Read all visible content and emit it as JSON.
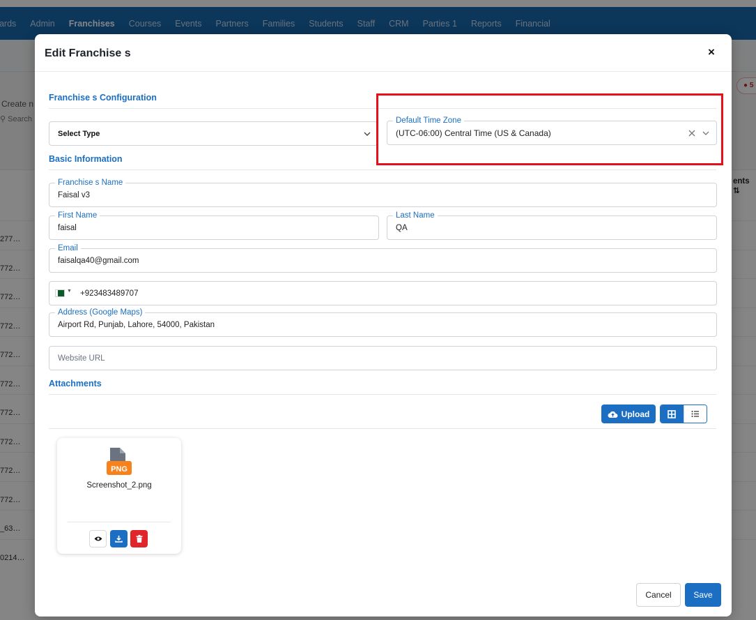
{
  "nav": {
    "items": [
      {
        "label": "oards",
        "active": false
      },
      {
        "label": "Admin",
        "active": false
      },
      {
        "label": "Franchises",
        "active": true
      },
      {
        "label": "Courses",
        "active": false
      },
      {
        "label": "Events",
        "active": false
      },
      {
        "label": "Partners",
        "active": false
      },
      {
        "label": "Families",
        "active": false
      },
      {
        "label": "Students",
        "active": false
      },
      {
        "label": "Staff",
        "active": false
      },
      {
        "label": "CRM",
        "active": false
      },
      {
        "label": "Parties 1",
        "active": false
      },
      {
        "label": "Reports",
        "active": false
      },
      {
        "label": "Financial",
        "active": false
      }
    ]
  },
  "background": {
    "create_label": "Create n",
    "search_label": "Search",
    "badge_text": "5",
    "column_header": "ents ⇅",
    "rows": [
      "277…",
      "772…",
      "772…",
      "772…",
      "772…",
      "772…",
      "772…",
      "772…",
      "772…",
      "772…",
      "_63…",
      "0214…"
    ]
  },
  "modal": {
    "title": "Edit Franchise s",
    "close_label": "×",
    "config_section": "Franchise s Configuration",
    "select_type": {
      "value": "Select Type"
    },
    "time_zone": {
      "label": "Default Time Zone",
      "value": "(UTC-06:00) Central Time (US & Canada)"
    },
    "basic_section": "Basic Information",
    "franchise_name": {
      "label": "Franchise s Name",
      "value": "Faisal v3"
    },
    "first_name": {
      "label": "First Name",
      "value": "faisal"
    },
    "last_name": {
      "label": "Last Name",
      "value": "QA"
    },
    "email": {
      "label": "Email",
      "value": "faisalqa40@gmail.com"
    },
    "phone": {
      "value": "+923483489707"
    },
    "address": {
      "label": "Address (Google Maps)",
      "value": "Airport Rd, Punjab, Lahore, 54000, Pakistan"
    },
    "website": {
      "placeholder": "Website URL"
    },
    "attachments_section": "Attachments",
    "upload_label": "Upload",
    "file": {
      "name": "Screenshot_2.png",
      "type_badge": "PNG"
    },
    "cancel_label": "Cancel",
    "save_label": "Save"
  },
  "colors": {
    "primary": "#1b6ec2",
    "navbar": "#1868ad",
    "highlight": "#e4101a",
    "danger": "#e0262b",
    "png_badge": "#f7821b"
  }
}
